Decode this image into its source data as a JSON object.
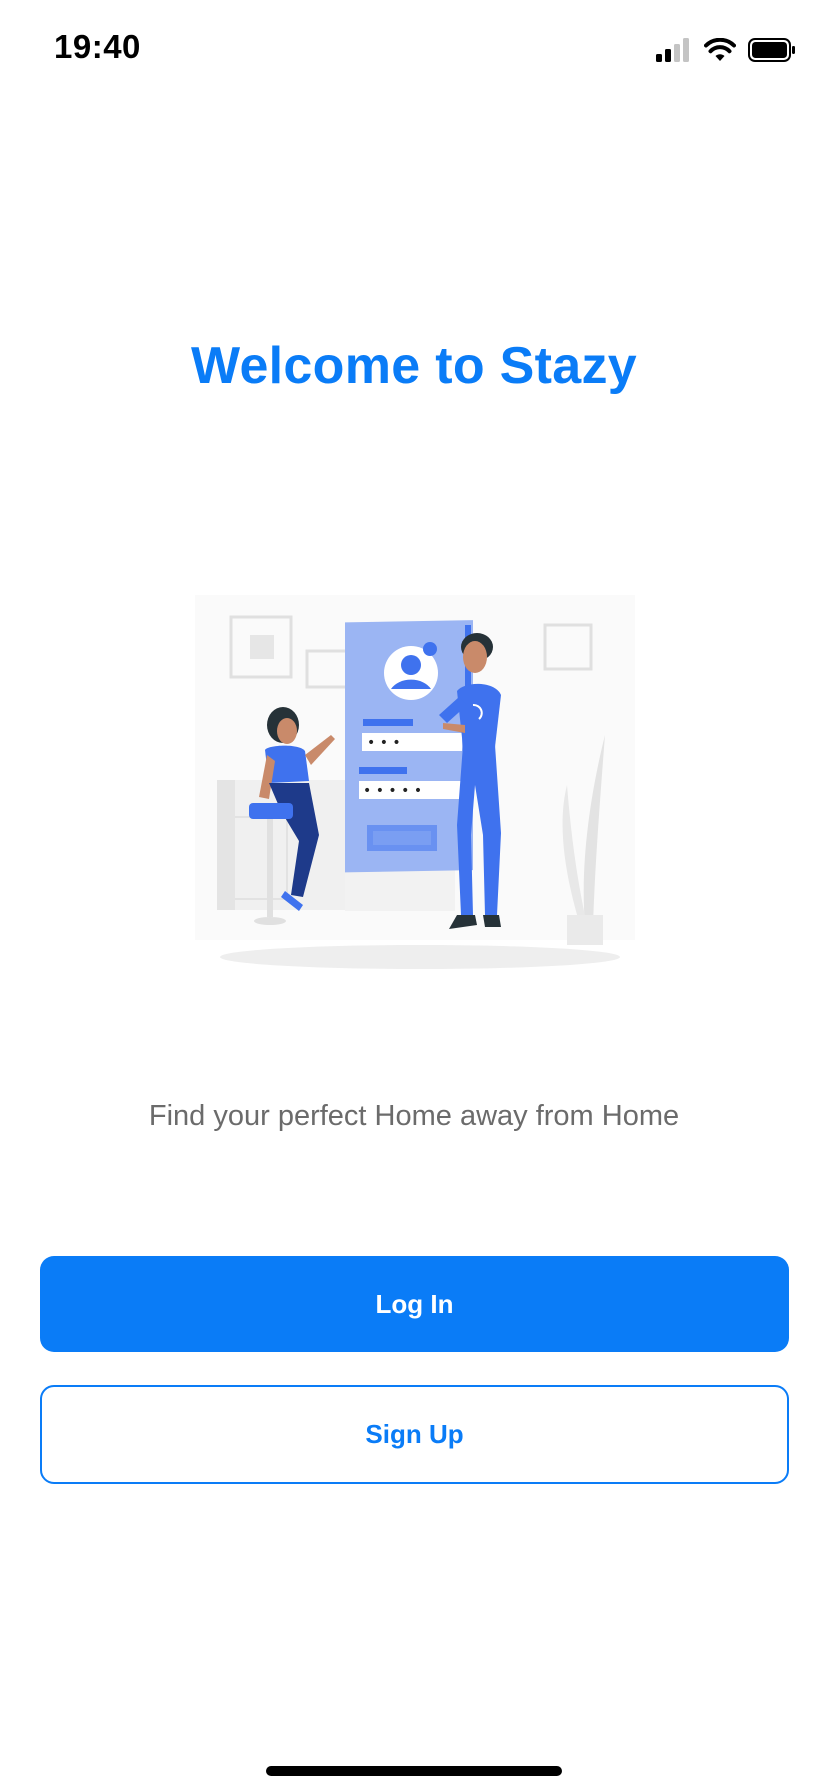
{
  "status_bar": {
    "time": "19:40",
    "icons": [
      "cellular-signal-icon",
      "wifi-icon",
      "battery-icon"
    ]
  },
  "welcome": {
    "title": "Welcome to Stazy",
    "tagline": "Find your perfect Home away from Home"
  },
  "illustration": {
    "name": "login-illustration",
    "password_dots_1": "• • •",
    "password_dots_2": "• • • • •"
  },
  "actions": {
    "login_label": "Log In",
    "signup_label": "Sign Up"
  },
  "colors": {
    "accent": "#0a7cf7",
    "tagline": "#6b6b6b",
    "illustration_blue": "#3f72ee",
    "illustration_light_blue": "#9bb5f3"
  }
}
